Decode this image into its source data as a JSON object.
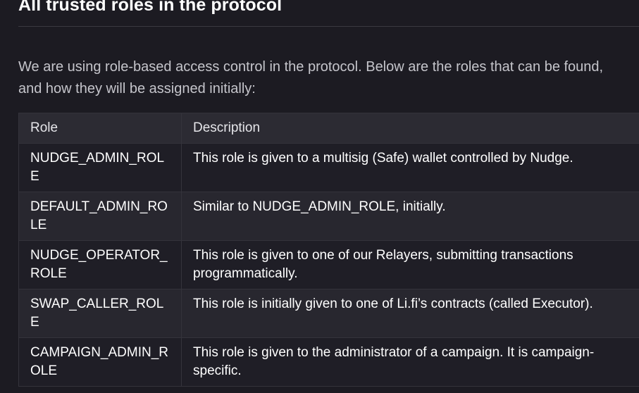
{
  "section": {
    "heading": "All trusted roles in the protocol",
    "intro": "We are using role-based access control in the protocol. Below are the roles that can be found, and how they will be assigned initially:"
  },
  "table": {
    "headers": {
      "role": "Role",
      "description": "Description"
    },
    "rows": [
      {
        "role": "NUDGE_ADMIN_ROLE",
        "description": "This role is given to a multisig (Safe) wallet controlled by Nudge."
      },
      {
        "role": "DEFAULT_ADMIN_ROLE",
        "description": "Similar to NUDGE_ADMIN_ROLE, initially."
      },
      {
        "role": "NUDGE_OPERATOR_ROLE",
        "description": "This role is given to one of our Relayers, submitting transactions programmatically."
      },
      {
        "role": "SWAP_CALLER_ROLE",
        "description": "This role is initially given to one of Li.fi’s contracts (called Executor)."
      },
      {
        "role": "CAMPAIGN_ADMIN_ROLE",
        "description": "This role is given to the administrator of a campaign. It is campaign-specific."
      }
    ]
  }
}
